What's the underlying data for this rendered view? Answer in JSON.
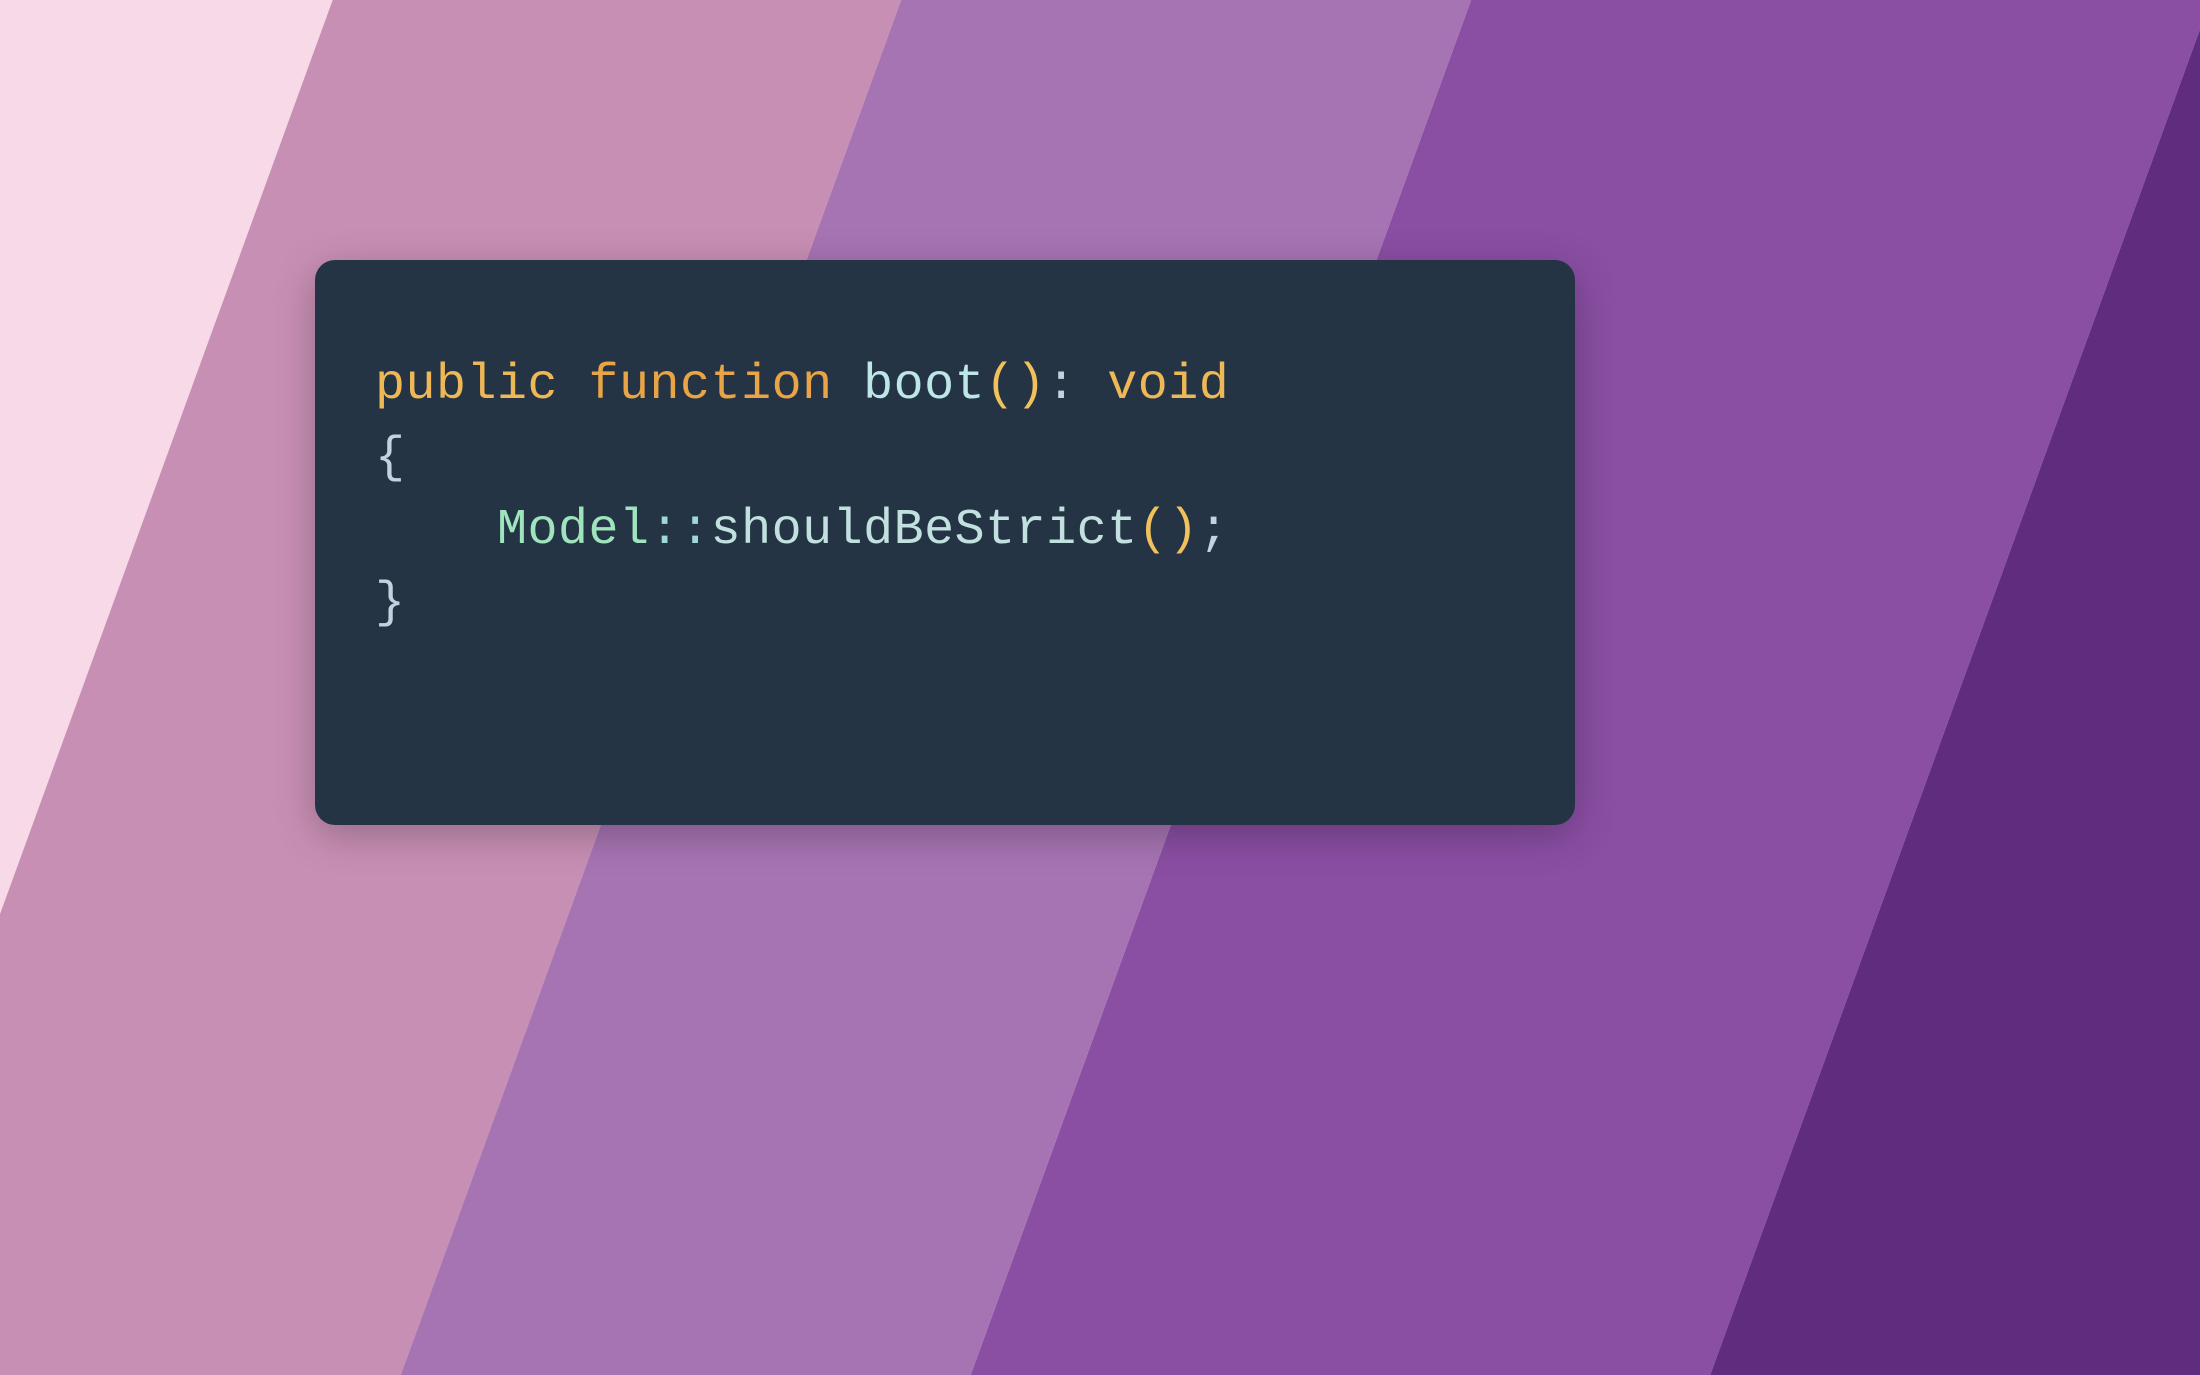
{
  "colors": {
    "stripes": [
      "#f7d9e8",
      "#c88fb4",
      "#a774b3",
      "#8a4ea3",
      "#5f2c7e"
    ],
    "code_bg": "#243444"
  },
  "code": {
    "line1": {
      "public": "public",
      "space1": " ",
      "function": "function",
      "space2": " ",
      "name": "boot",
      "parens": "()",
      "colon": ":",
      "space3": " ",
      "void": "void"
    },
    "line2": {
      "open_brace": "{"
    },
    "line3": {
      "indent": "    ",
      "class": "Model",
      "scope": "::",
      "method": "shouldBeStrict",
      "parens": "()",
      "semi": ";"
    },
    "line4": {
      "close_brace": "}"
    }
  }
}
